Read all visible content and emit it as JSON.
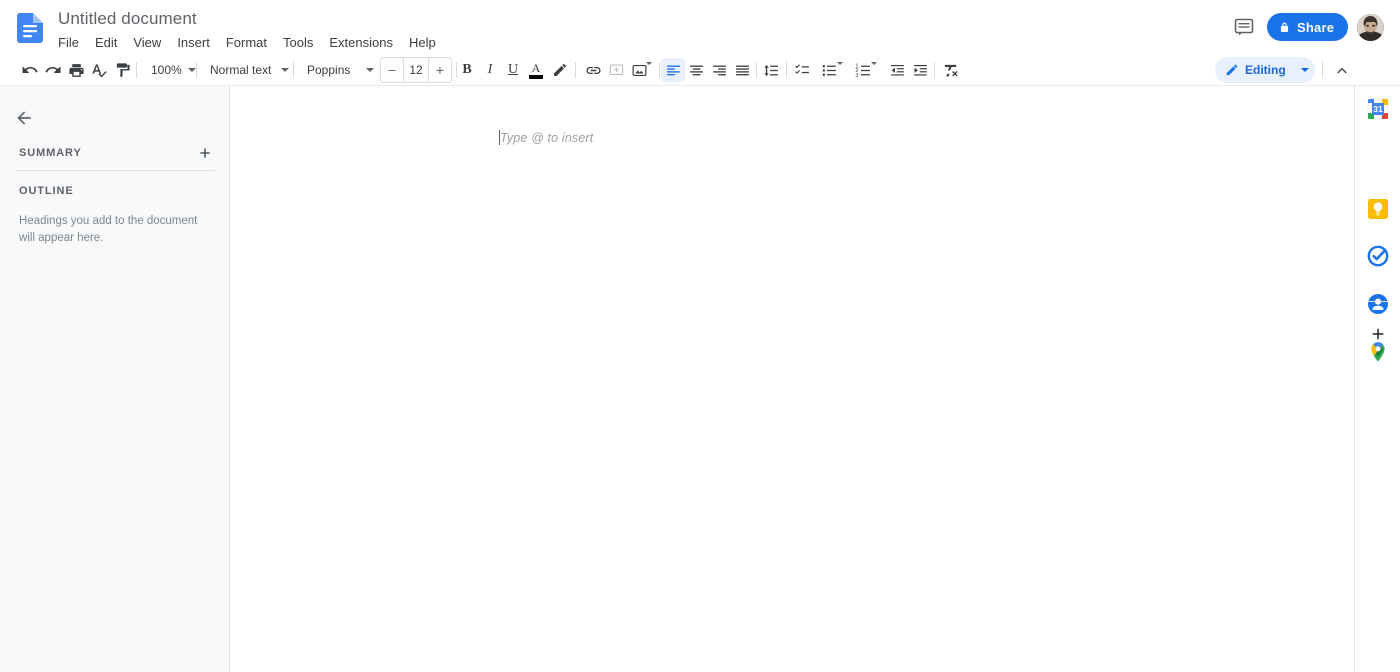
{
  "app": {
    "name": "Google Docs",
    "logo_icon": "docs-file-icon"
  },
  "header": {
    "doc_title": "Untitled document",
    "menu_items": [
      {
        "label": "File"
      },
      {
        "label": "Edit"
      },
      {
        "label": "View"
      },
      {
        "label": "Insert"
      },
      {
        "label": "Format"
      },
      {
        "label": "Tools"
      },
      {
        "label": "Extensions"
      },
      {
        "label": "Help"
      }
    ],
    "comment_history_icon": "comment-history-icon",
    "share": {
      "label": "Share",
      "icon": "lock-icon",
      "bg_color": "#1a73e8",
      "text_color": "#ffffff"
    },
    "avatar_icon": "user-avatar"
  },
  "toolbar": {
    "undo_icon": "undo-icon",
    "redo_icon": "redo-icon",
    "print_icon": "print-icon",
    "spellcheck_icon": "spellcheck-icon",
    "paint_format_icon": "paint-format-icon",
    "zoom": {
      "value": "100%",
      "caret_icon": "chevron-down-icon"
    },
    "paragraph_style": {
      "value": "Normal text",
      "caret_icon": "chevron-down-icon"
    },
    "font": {
      "value": "Poppins",
      "caret_icon": "chevron-down-icon"
    },
    "font_size": {
      "decrease_label": "−",
      "value": "12",
      "increase_label": "+"
    },
    "bold_label": "B",
    "italic_label": "I",
    "underline_label": "U",
    "text_color": {
      "letter": "A",
      "swatch_color": "#000000"
    },
    "highlight_icon": "highlight-pen-icon",
    "link_icon": "insert-link-icon",
    "comment_icon": "add-comment-icon",
    "image_icon": "insert-image-icon",
    "align_left_icon": "align-left-icon",
    "align_center_icon": "align-center-icon",
    "align_right_icon": "align-right-icon",
    "align_justify_icon": "align-justify-icon",
    "line_spacing_icon": "line-spacing-icon",
    "checklist_icon": "checklist-icon",
    "bulleted_list_icon": "bulleted-list-icon",
    "numbered_list_icon": "numbered-list-icon",
    "decrease_indent_icon": "decrease-indent-icon",
    "increase_indent_icon": "increase-indent-icon",
    "clear_formatting_icon": "clear-formatting-icon",
    "active_alignment": "left",
    "editing_mode": {
      "label": "Editing",
      "icon": "pencil-icon",
      "caret_icon": "chevron-down-icon",
      "chip_bg": "#e8f0fe",
      "chip_text_color": "#1967d2"
    },
    "collapse_icon": "chevron-up-icon"
  },
  "left_sidebar": {
    "back_icon": "arrow-left-icon",
    "summary": {
      "title": "SUMMARY",
      "add_icon": "plus-icon"
    },
    "outline": {
      "title": "OUTLINE",
      "empty_text": "Headings you add to the document will appear here."
    }
  },
  "document": {
    "placeholder": "Type @ to insert",
    "caret_visible": true
  },
  "right_panel": {
    "apps": [
      {
        "name": "google-calendar",
        "label": "Calendar",
        "badge": "31"
      },
      {
        "name": "google-keep",
        "label": "Keep"
      },
      {
        "name": "google-tasks",
        "label": "Tasks"
      },
      {
        "name": "google-contacts",
        "label": "Contacts"
      },
      {
        "name": "google-maps",
        "label": "Maps"
      }
    ],
    "add_icon": "plus-icon",
    "add_label": "Get add-ons"
  }
}
